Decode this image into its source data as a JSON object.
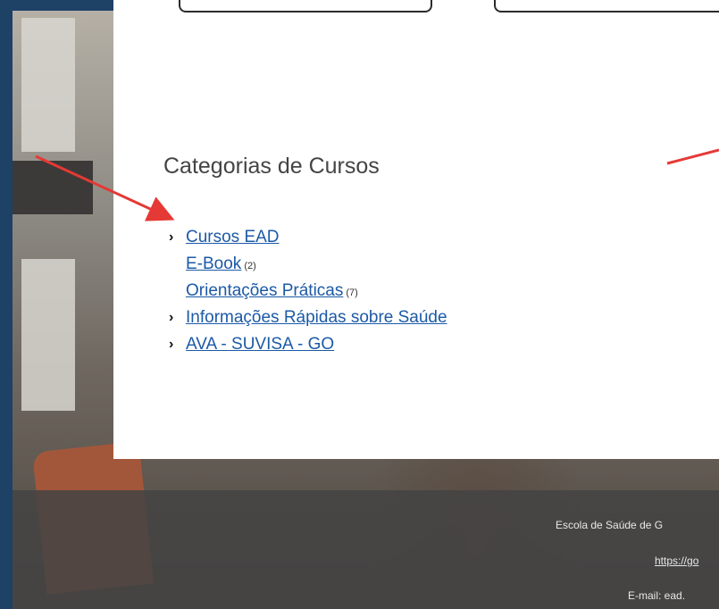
{
  "categories": {
    "title": "Categorias de Cursos",
    "items": [
      {
        "label": "Cursos EAD",
        "count": "",
        "expandable": true,
        "level": 0
      },
      {
        "label": "E-Book",
        "count": "(2)",
        "expandable": false,
        "level": 1
      },
      {
        "label": "Orientações Práticas",
        "count": "(7)",
        "expandable": false,
        "level": 1
      },
      {
        "label": "Informações Rápidas sobre Saúde",
        "count": "",
        "expandable": true,
        "level": 0
      },
      {
        "label": "AVA - SUVISA - GO",
        "count": "",
        "expandable": true,
        "level": 0
      }
    ]
  },
  "footer": {
    "school": "Escola de Saúde de G",
    "url": "https://go",
    "email": "E-mail: ead."
  },
  "colors": {
    "link": "#1c5aa6",
    "annotation_arrow": "#e53935",
    "border": "#1e4166"
  },
  "icons": {
    "chevron": "chevron-right-icon"
  }
}
